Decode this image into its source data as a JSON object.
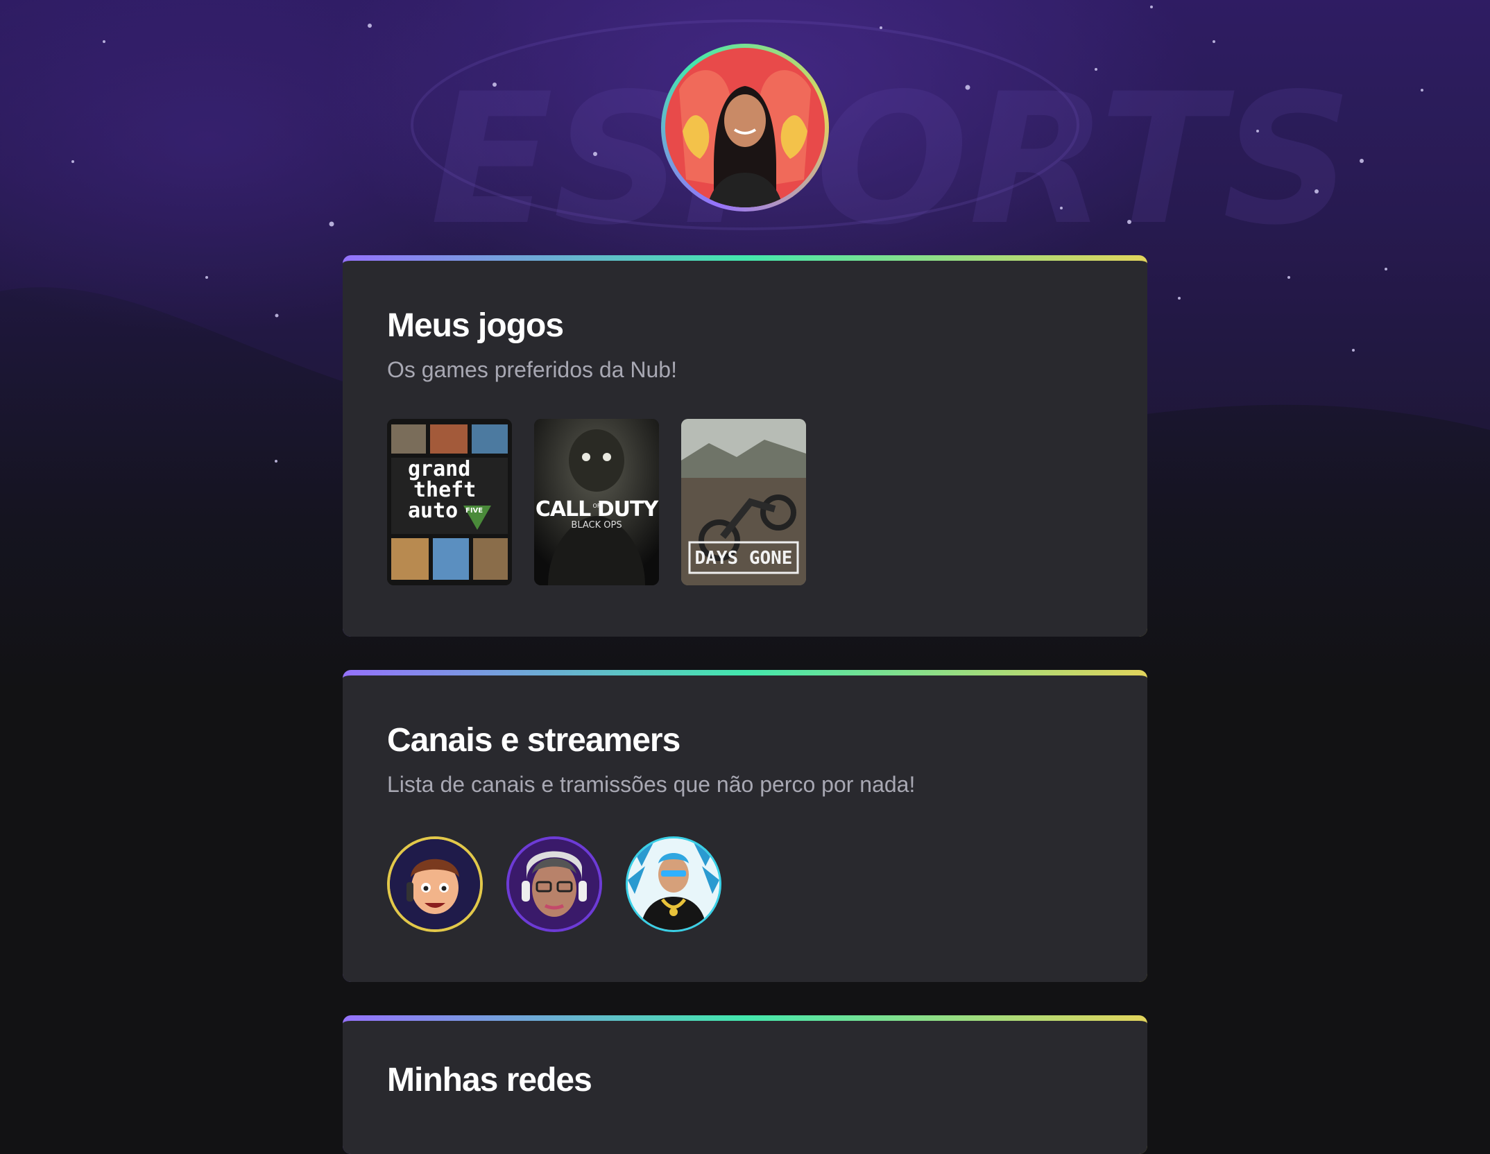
{
  "profile": {
    "avatar_icon": "profile-photo-icon",
    "ring_colors": [
      "#9572fc",
      "#43e7ad",
      "#e2d45c"
    ]
  },
  "games_section": {
    "title": "Meus jogos",
    "subtitle": "Os games preferidos da Nub!",
    "games": [
      {
        "line1": "grand",
        "line2": "theft",
        "line3": "auto",
        "badge": "FIVE",
        "icon": "gta-v-cover-icon"
      },
      {
        "title": "CALL DUTY",
        "of": "OF",
        "subtitle": "BLACK OPS",
        "icon": "call-of-duty-cover-icon"
      },
      {
        "title": "DAYS GONE",
        "icon": "days-gone-cover-icon"
      }
    ]
  },
  "streamers_section": {
    "title": "Canais e streamers",
    "subtitle": "Lista de canais e tramissões que não perco por nada!",
    "streamers": [
      {
        "icon": "streamer-avatar-1-icon",
        "ring": "#e2c84a"
      },
      {
        "icon": "streamer-avatar-2-icon",
        "ring": "#6d3bd6"
      },
      {
        "icon": "streamer-avatar-3-icon",
        "ring": "#3ad0e6"
      }
    ]
  },
  "socials_section": {
    "title": "Minhas redes"
  },
  "colors": {
    "background": "#121214",
    "card": "#29292e",
    "subtitle": "#a8a8b3",
    "accent_gradient": [
      "#9572fc",
      "#43e7ad",
      "#e2d45c"
    ]
  }
}
